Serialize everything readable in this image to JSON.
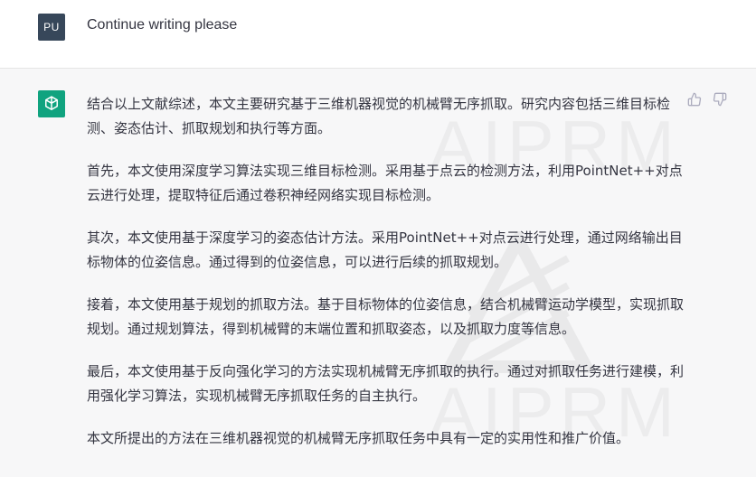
{
  "user": {
    "avatar_initials": "PU",
    "message": "Continue writing please"
  },
  "assistant": {
    "avatar_icon": "openai-logo-icon",
    "avatar_color": "#10a37f",
    "paragraphs": [
      "结合以上文献综述，本文主要研究基于三维机器视觉的机械臂无序抓取。研究内容包括三维目标检测、姿态估计、抓取规划和执行等方面。",
      "首先，本文使用深度学习算法实现三维目标检测。采用基于点云的检测方法，利用PointNet++对点云进行处理，提取特征后通过卷积神经网络实现目标检测。",
      "其次，本文使用基于深度学习的姿态估计方法。采用PointNet++对点云进行处理，通过网络输出目标物体的位姿信息。通过得到的位姿信息，可以进行后续的抓取规划。",
      "接着，本文使用基于规划的抓取方法。基于目标物体的位姿信息，结合机械臂运动学模型，实现抓取规划。通过规划算法，得到机械臂的末端位置和抓取姿态，以及抓取力度等信息。",
      "最后，本文使用基于反向强化学习的方法实现机械臂无序抓取的执行。通过对抓取任务进行建模，利用强化学习算法，实现机械臂无序抓取任务的自主执行。",
      "本文所提出的方法在三维机器视觉的机械臂无序抓取任务中具有一定的实用性和推广价值。"
    ],
    "actions": [
      "thumbs-up-icon",
      "thumbs-down-icon"
    ]
  },
  "watermark": {
    "text": "AIPRM"
  }
}
